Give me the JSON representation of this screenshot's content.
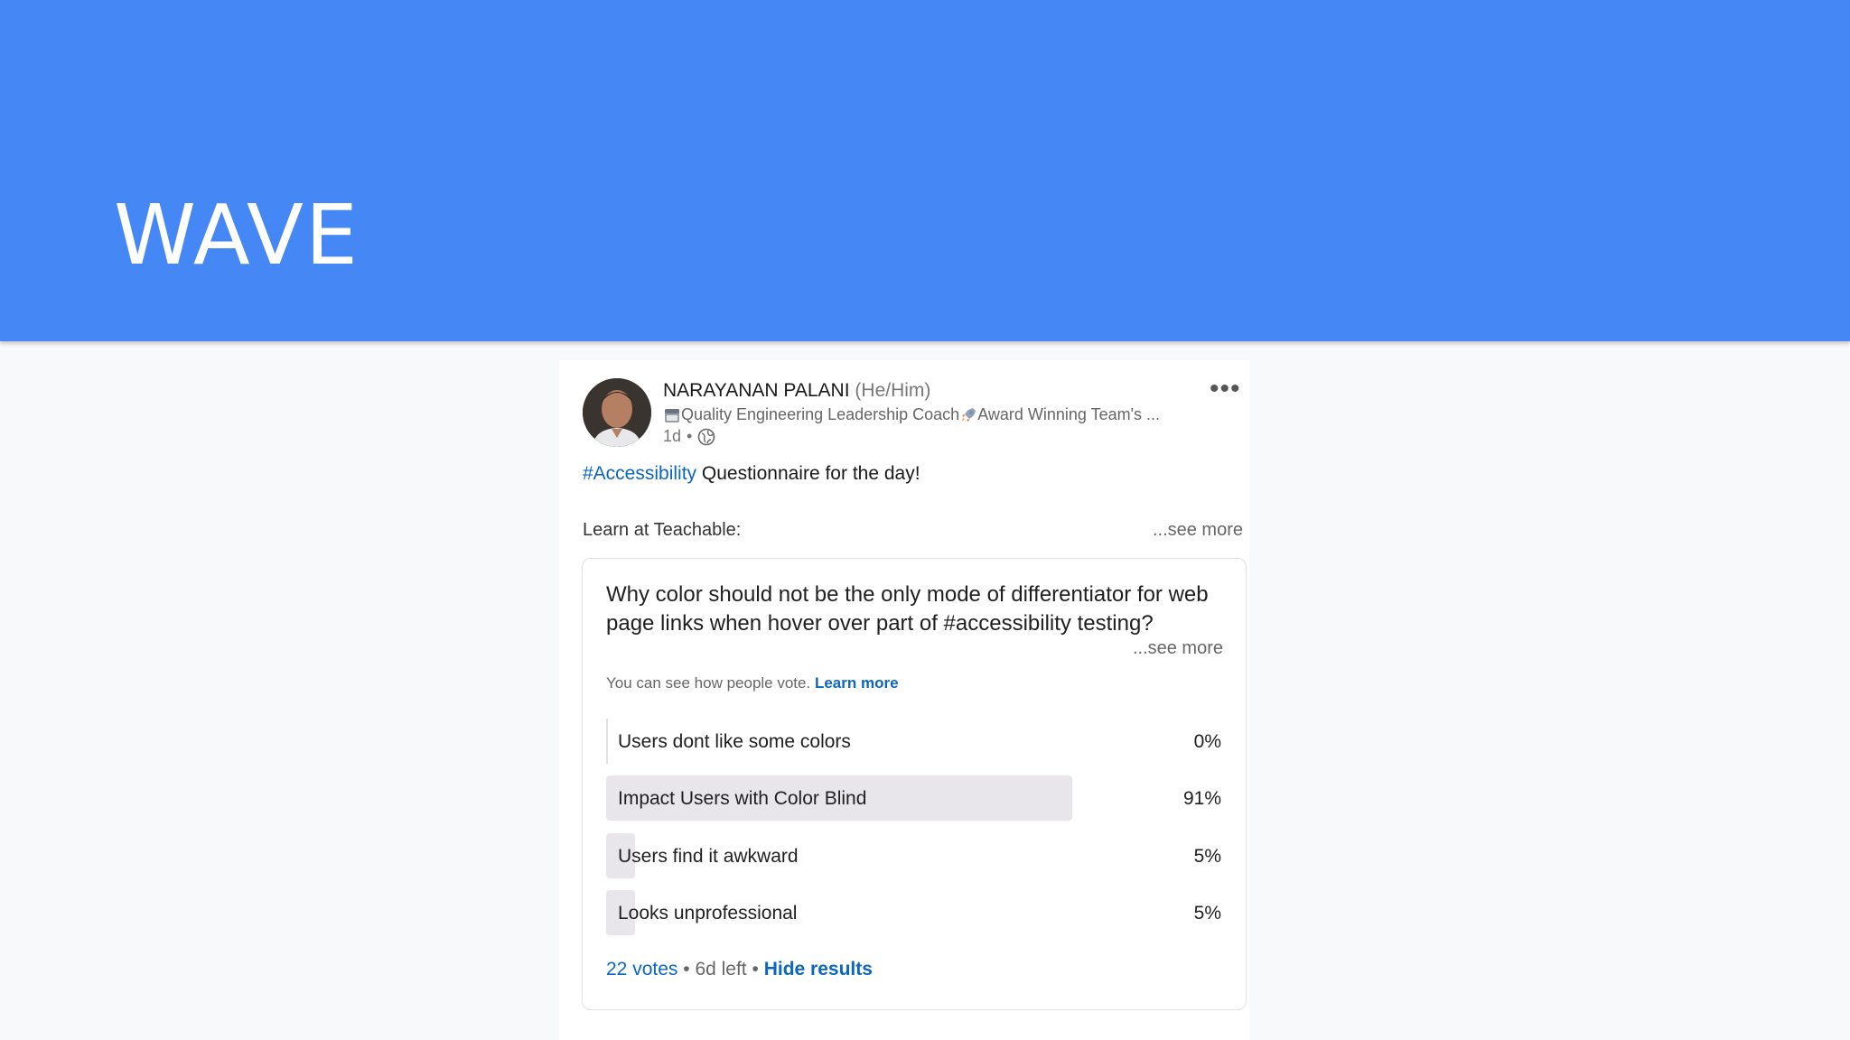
{
  "slide": {
    "title": "WAVE"
  },
  "colors": {
    "banner": "#4587f4",
    "link": "#0a66c2",
    "bar_fill": "#e8e6ea"
  },
  "post": {
    "author_name": "NARAYANAN PALANI",
    "pronouns": "(He/Him)",
    "headline_part1": "Quality Engineering Leadership Coach",
    "headline_part2": "Award Winning Team's ...",
    "time": "1d",
    "separator": "•",
    "visibility_icon": "globe-icon",
    "more_icon": "•••",
    "hashtag": "#Accessibility",
    "text": "Questionnaire for the day!",
    "learn_line": "Learn at Teachable:",
    "see_more": "...see more"
  },
  "poll": {
    "question": "Why color should not be the only mode of differentiator for web page links when hover over part of #accessibility testing?",
    "see_more": "...see more",
    "visibility_note": "You can see how people vote.",
    "learn_more": "Learn more",
    "options": [
      {
        "label": "Users dont like some colors",
        "percent_text": "0%",
        "percent": 0
      },
      {
        "label": "Impact Users with Color Blind",
        "percent_text": "91%",
        "percent": 91
      },
      {
        "label": "Users find it awkward",
        "percent_text": "5%",
        "percent": 5
      },
      {
        "label": "Looks unprofessional",
        "percent_text": "5%",
        "percent": 5
      }
    ],
    "votes": "22 votes",
    "dot": "•",
    "time_left": "6d left",
    "hide_results": "Hide results"
  }
}
